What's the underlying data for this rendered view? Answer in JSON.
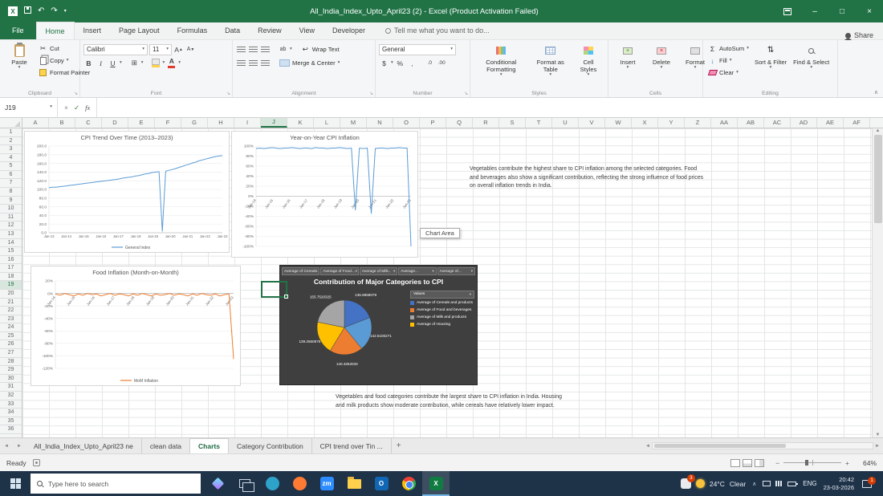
{
  "window": {
    "title": "All_India_Index_Upto_April23 (2) - Excel (Product Activation Failed)"
  },
  "icons": {
    "dropdown": "▾",
    "undo": "↶",
    "redo": "↷",
    "close": "×",
    "minimize": "–",
    "maximize": "□",
    "check": "✓",
    "cross": "×",
    "launcher": "↘",
    "left": "◄",
    "right": "►",
    "up": "▲",
    "down": "▼",
    "plus": "+",
    "minus": "−",
    "sigma": "Σ",
    "wrap": "↩",
    "align": "≡",
    "merge_glyph": "⊟",
    "borders": "⊞",
    "fill_arrow": "↓",
    "sort_glyph": "⇅",
    "chevron_up": "∧",
    "excel_logo": "X",
    "scissors": "✂",
    "dollar": "$"
  },
  "ribbon": {
    "tabs": [
      {
        "label": "File",
        "file": true
      },
      {
        "label": "Home",
        "active": true
      },
      {
        "label": "Insert"
      },
      {
        "label": "Page Layout"
      },
      {
        "label": "Formulas"
      },
      {
        "label": "Data"
      },
      {
        "label": "Review"
      },
      {
        "label": "View"
      },
      {
        "label": "Developer"
      }
    ],
    "tell_me": "Tell me what you want to do...",
    "share": "Share",
    "groups": {
      "clipboard": {
        "label": "Clipboard",
        "paste": "Paste",
        "cut": "Cut",
        "copy": "Copy",
        "format_painter": "Format Painter"
      },
      "font": {
        "label": "Font",
        "name": "Calibri",
        "size": "11",
        "bold": "B",
        "italic": "I",
        "underline": "U"
      },
      "alignment": {
        "label": "Alignment",
        "wrap_text": "Wrap Text",
        "merge_center": "Merge & Center"
      },
      "number": {
        "label": "Number",
        "format": "General",
        "percent": "%",
        "comma": ",",
        "dec0": ".0",
        "dec00": ".00"
      },
      "styles": {
        "label": "Styles",
        "conditional": "Conditional Formatting",
        "format_table": "Format as Table",
        "cell_styles": "Cell Styles"
      },
      "cells": {
        "label": "Cells",
        "insert": "Insert",
        "delete": "Delete",
        "format": "Format"
      },
      "editing": {
        "label": "Editing",
        "autosum": "AutoSum",
        "fill": "Fill",
        "clear": "Clear",
        "sort_filter": "Sort & Filter",
        "find_select": "Find & Select"
      }
    }
  },
  "formula_bar": {
    "name_box": "J19",
    "fx": "fx",
    "value": ""
  },
  "grid": {
    "columns": [
      "A",
      "B",
      "C",
      "D",
      "E",
      "F",
      "G",
      "H",
      "I",
      "J",
      "K",
      "L",
      "M",
      "N",
      "O",
      "P",
      "Q",
      "R",
      "S",
      "T",
      "U",
      "V",
      "W",
      "X",
      "Y",
      "Z",
      "AA",
      "AB",
      "AC",
      "AD",
      "AE",
      "AF"
    ],
    "row_count": 36,
    "active_cell": {
      "col": "J",
      "row": 19
    }
  },
  "tooltip": "Chart Area",
  "notes": {
    "note1": "Vegetables contribute the highest share to CPI inflation among the selected categories. Food and beverages also show a significant contribution, reflecting the strong influence of food prices on overall inflation trends in India.",
    "note2": "Vegetables and food categories contribute the largest share to CPI inflation in India. Housing and milk products show moderate contribution, while cereals have relatively lower impact."
  },
  "chart_data": [
    {
      "id": "cpi-trend",
      "target": "chart-cpi-trend",
      "type": "line",
      "title": "CPI Trend Over Time (2013–2023)",
      "ymin": 0,
      "ymax": 200,
      "yticks": [
        "200.0",
        "180.0",
        "160.0",
        "140.0",
        "120.0",
        "100.0",
        "80.0",
        "60.0",
        "40.0",
        "20.0",
        "0.0"
      ],
      "xlabels": [
        "Jan-13",
        "Jan-14",
        "Jan-15",
        "Jan-16",
        "Jan-17",
        "Jan-18",
        "Jan-19",
        "Jan-20",
        "Jan-21",
        "Jan-22",
        "Jan-23"
      ],
      "rotate": false,
      "legend_visible": true,
      "grid": true,
      "series": [
        {
          "name": "General Index",
          "color": "#5B9BD5",
          "values": [
            104,
            105,
            105,
            106,
            107,
            108,
            109,
            110,
            111,
            112,
            113,
            114,
            115,
            116,
            117,
            118,
            119,
            120,
            121,
            122,
            123,
            124,
            126,
            127,
            128,
            129,
            131,
            132,
            134,
            136,
            137,
            139,
            140,
            141,
            3,
            142,
            144,
            146,
            148,
            151,
            153,
            156,
            158,
            161,
            163,
            166,
            168,
            170,
            172,
            174,
            176,
            177,
            178
          ]
        }
      ]
    },
    {
      "id": "yoy-inflation",
      "target": "chart-yoy-inflation",
      "type": "line",
      "title": "Year-on-Year CPI Inflation",
      "ymin": -100,
      "ymax": 100,
      "yticks": [
        "100%",
        "80%",
        "60%",
        "40%",
        "20%",
        "0%",
        "-20%",
        "-40%",
        "-60%",
        "-80%",
        "-100%"
      ],
      "xlabels": [
        "Jan-14",
        "Jan-15",
        "Jan-16",
        "Jan-17",
        "Jan-18",
        "Jan-19",
        "Jan-20",
        "Jan-21",
        "Jan-22",
        "Jan-23"
      ],
      "rotate": true,
      "legend_visible": false,
      "grid": false,
      "series": [
        {
          "name": "YoY Inflation",
          "color": "#5B9BD5",
          "values": [
            95,
            96,
            95,
            96,
            97,
            96,
            95,
            96,
            96,
            97,
            96,
            95,
            96,
            96,
            95,
            97,
            96,
            96,
            95,
            96,
            96,
            97,
            96,
            95,
            96,
            -28,
            96,
            95,
            96,
            -35,
            95,
            96,
            96,
            95,
            96,
            96,
            97,
            96,
            96,
            -100
          ]
        }
      ]
    },
    {
      "id": "food-inflation",
      "target": "chart-food-inflation",
      "type": "line",
      "title": "Food Inflation (Month-on-Month)",
      "ymin": -120,
      "ymax": 20,
      "yticks": [
        "20%",
        "0%",
        "-20%",
        "-40%",
        "-60%",
        "-80%",
        "-100%",
        "-120%"
      ],
      "xlabels": [
        "Jan-14",
        "Jan-15",
        "Jan-16",
        "Jan-17",
        "Jan-18",
        "Jan-19",
        "Jan-20",
        "Jan-21",
        "Jan-22",
        "Jan-23"
      ],
      "rotate": true,
      "legend_visible": true,
      "grid": false,
      "series": [
        {
          "name": "MoM Inflation",
          "color": "#ED7D31",
          "values": [
            -1,
            -3,
            0,
            -2,
            -4,
            -1,
            -3,
            0,
            -2,
            -1,
            -4,
            -2,
            0,
            -3,
            -1,
            -2,
            -4,
            -1,
            -3,
            0,
            -2,
            -4,
            -1,
            -3,
            -2,
            0,
            -3,
            -1,
            -2,
            -4,
            -1,
            -3,
            0,
            -2,
            -3,
            -1,
            -4,
            -2,
            -1,
            -105
          ]
        }
      ]
    },
    {
      "id": "category-pie",
      "target": "pivot-chart",
      "type": "pie",
      "title": "Contribution of Major Categories to CPI",
      "field_buttons": [
        "Average of Cereals.",
        "Average of Food...",
        "Average of Milk..",
        "Average...",
        "Average of..."
      ],
      "legend_title": "Values",
      "legend": [
        {
          "label": "Average of Cereals and products",
          "color": "#4472C4"
        },
        {
          "label": "Average of Food and beverages",
          "color": "#ED7D31"
        },
        {
          "label": "Average of Milk and products",
          "color": "#A5A5A5"
        },
        {
          "label": "Average of Housing",
          "color": "#FFC000"
        }
      ],
      "slices": [
        {
          "label": "136.6859079",
          "value": 136.6859079,
          "color": "#4472C4"
        },
        {
          "label": "142.5100271",
          "value": 142.5100271,
          "color": "#5B9BD5"
        },
        {
          "label": "140.3252033",
          "value": 140.3252033,
          "color": "#ED7D31"
        },
        {
          "label": "139.2560976",
          "value": 139.2560976,
          "color": "#FFC000"
        },
        {
          "label": "155.7520325",
          "value": 155.7520325,
          "color": "#A5A5A5"
        }
      ]
    }
  ],
  "sheet_tabs": {
    "tabs": [
      {
        "label": "All_India_Index_Upto_April23 ne"
      },
      {
        "label": "clean data"
      },
      {
        "label": "Charts",
        "active": true
      },
      {
        "label": "Category Contribution"
      },
      {
        "label": "CPI trend over Tin ..."
      }
    ],
    "add_label": "+"
  },
  "status_bar": {
    "mode": "Ready",
    "zoom": "64%"
  },
  "taskbar": {
    "search_placeholder": "Type here to search",
    "apps": [
      {
        "name": "copilot",
        "shape": "star"
      },
      {
        "name": "task-view",
        "shape": "taskview"
      },
      {
        "name": "edge",
        "shape": "circle",
        "color": "#2ea3c9"
      },
      {
        "name": "firefox",
        "shape": "circle",
        "color": "#ff7a33"
      },
      {
        "name": "zoom",
        "shape": "square",
        "color": "#2d8cff",
        "text": "zm"
      },
      {
        "name": "file-explorer",
        "shape": "folder"
      },
      {
        "name": "outlook",
        "shape": "square",
        "color": "#1267b4",
        "text": "O"
      },
      {
        "name": "chrome",
        "shape": "chrome"
      },
      {
        "name": "excel",
        "shape": "square",
        "color": "#107c41",
        "text": "X",
        "active": true
      }
    ],
    "tray": {
      "alert_badge": "3",
      "temp": "24°C",
      "weather": "Clear",
      "hidden_icons": "∧",
      "lang": "ENG",
      "time": "20:42",
      "date": "23-03-2026",
      "notification_badge": "1"
    }
  }
}
